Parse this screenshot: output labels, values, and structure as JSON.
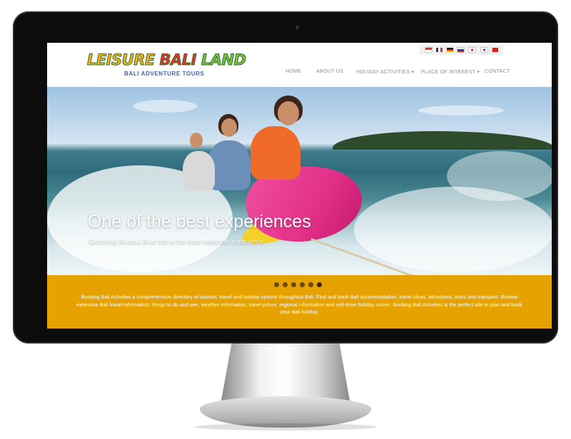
{
  "logo": {
    "word1": "LEISURE",
    "word2": "BALI",
    "word3": "LAND",
    "tagline": "BALI ADVENTURE TOURS"
  },
  "language_flags": [
    "indonesia-flag-icon",
    "france-flag-icon",
    "germany-flag-icon",
    "russia-flag-icon",
    "japan-flag-icon",
    "korea-flag-icon",
    "china-flag-icon"
  ],
  "nav": {
    "items": [
      {
        "label": "HOME"
      },
      {
        "label": "ABOUT US"
      },
      {
        "label": "HOLIDAY ACTIVITIES ▾"
      },
      {
        "label": "PLACE OF INTEREST ▾"
      },
      {
        "label": "CONTACT"
      }
    ]
  },
  "hero": {
    "title": "One of the best experiences",
    "subtitle": "Gathering Banana Boat ride is the most enjoyable experience"
  },
  "slider": {
    "dot_count": 6,
    "active_index": 5
  },
  "intro": {
    "text": "Booking Bali Activities a comprehensive directory of tourism, travel and holiday options throughout Bali. Find and book Bali accommodation, travel ideas, attractions, tours and transport. Browse extensive Bali travel information, things to do and see, weather information, travel prizes, regional information and self-drive holiday routes. Booking Bali Activities is the perfect site to plan and book your Bali holiday."
  },
  "colors": {
    "band": "#e5a200",
    "nav_text": "#8c8c8c",
    "bezel": "#0c0c0c"
  }
}
